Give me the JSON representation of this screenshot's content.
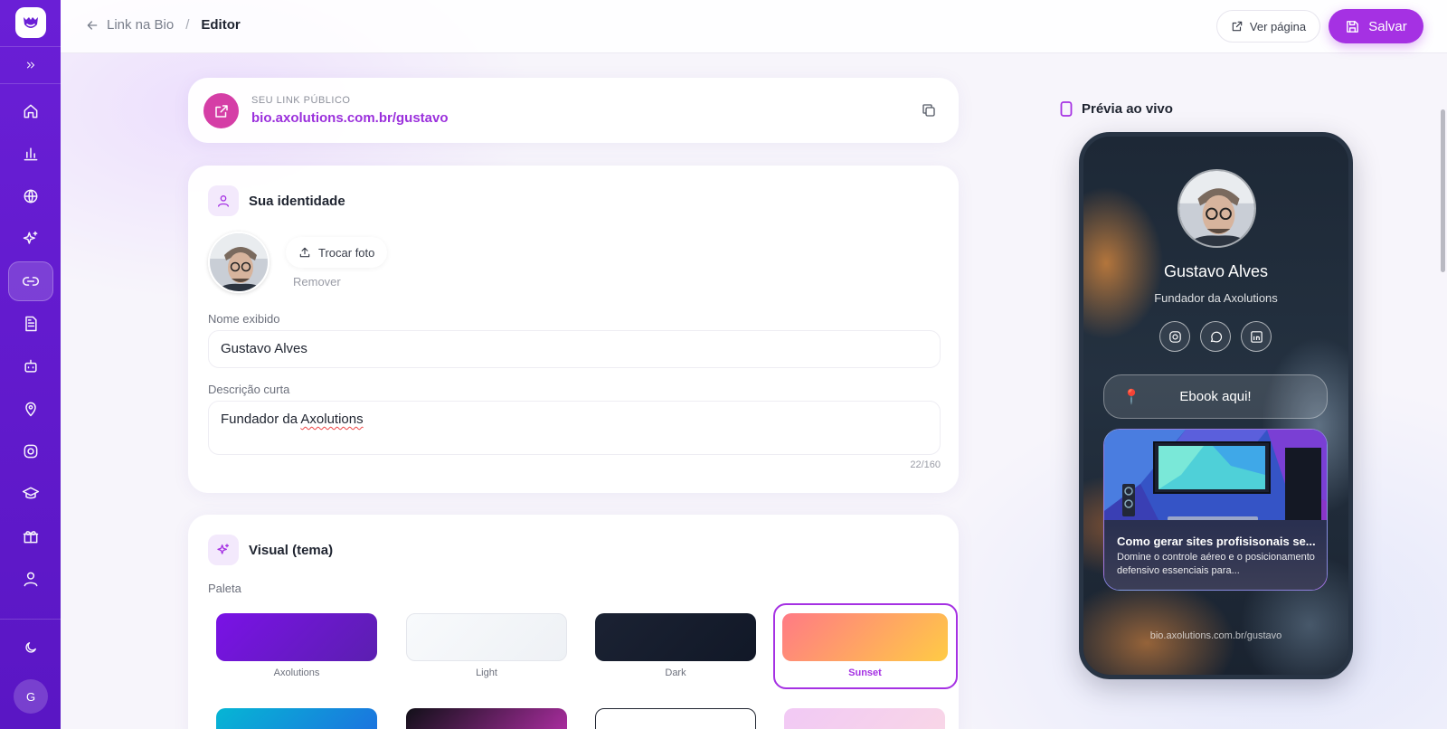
{
  "sidebar": {
    "avatar_initial": "G",
    "items": [
      {
        "icon": "home-icon"
      },
      {
        "icon": "bar-chart-icon"
      },
      {
        "icon": "globe-icon"
      },
      {
        "icon": "sparkles-icon"
      },
      {
        "icon": "link-icon",
        "active": true
      },
      {
        "icon": "file-text-icon"
      },
      {
        "icon": "bot-icon"
      },
      {
        "icon": "map-pin-icon"
      },
      {
        "icon": "instagram-icon"
      },
      {
        "icon": "graduation-cap-icon"
      },
      {
        "icon": "gift-icon"
      },
      {
        "icon": "user-icon"
      }
    ]
  },
  "header": {
    "breadcrumb_parent": "Link na Bio",
    "breadcrumb_sep": "/",
    "breadcrumb_current": "Editor",
    "view_page_label": "Ver página",
    "save_label": "Salvar"
  },
  "public_link": {
    "label": "SEU LINK PÚBLICO",
    "url": "bio.axolutions.com.br/gustavo"
  },
  "identity": {
    "title": "Sua identidade",
    "change_photo_label": "Trocar foto",
    "remove_label": "Remover",
    "name_label": "Nome exibido",
    "name_value": "Gustavo Alves",
    "desc_label": "Descrição curta",
    "desc_value_prefix": "Fundador da ",
    "desc_value_word": "Axolutions",
    "counter": "22/160"
  },
  "visual": {
    "title": "Visual (tema)",
    "palette_label": "Paleta",
    "palettes": [
      {
        "name": "Axolutions",
        "colors": [
          "#7a12e6",
          "#5b1fb0"
        ]
      },
      {
        "name": "Light",
        "colors": [
          "#f8fafc",
          "#eef1f5"
        ]
      },
      {
        "name": "Dark",
        "colors": [
          "#1b2233",
          "#111827"
        ]
      },
      {
        "name": "Sunset",
        "colors": [
          "#ff7a85",
          "#ffcb45"
        ],
        "selected": true
      }
    ],
    "palettes_row2_colors": [
      [
        "#06b6d4",
        "#1d6fe0"
      ],
      [
        "#111018",
        "#b42fa8"
      ],
      [
        "#ffffff",
        "#ffffff"
      ],
      [
        "#f1c9f5",
        "#f9d7e6"
      ]
    ]
  },
  "preview": {
    "title": "Prévia ao vivo",
    "name": "Gustavo Alves",
    "description": "Fundador da Axolutions",
    "social_icons": [
      "instagram-icon",
      "whatsapp-icon",
      "linkedin-icon"
    ],
    "button_label": "Ebook aqui!",
    "media_title": "Como gerar sites profisisonais se...",
    "media_subtitle": "Domine o controle aéreo e o posicionamento defensivo essenciais para...",
    "footer_url": "bio.axolutions.com.br/gustavo"
  },
  "colors": {
    "sidebar": "#5a16c4",
    "accent": "#a531e3",
    "link_text": "#9b30dc"
  }
}
